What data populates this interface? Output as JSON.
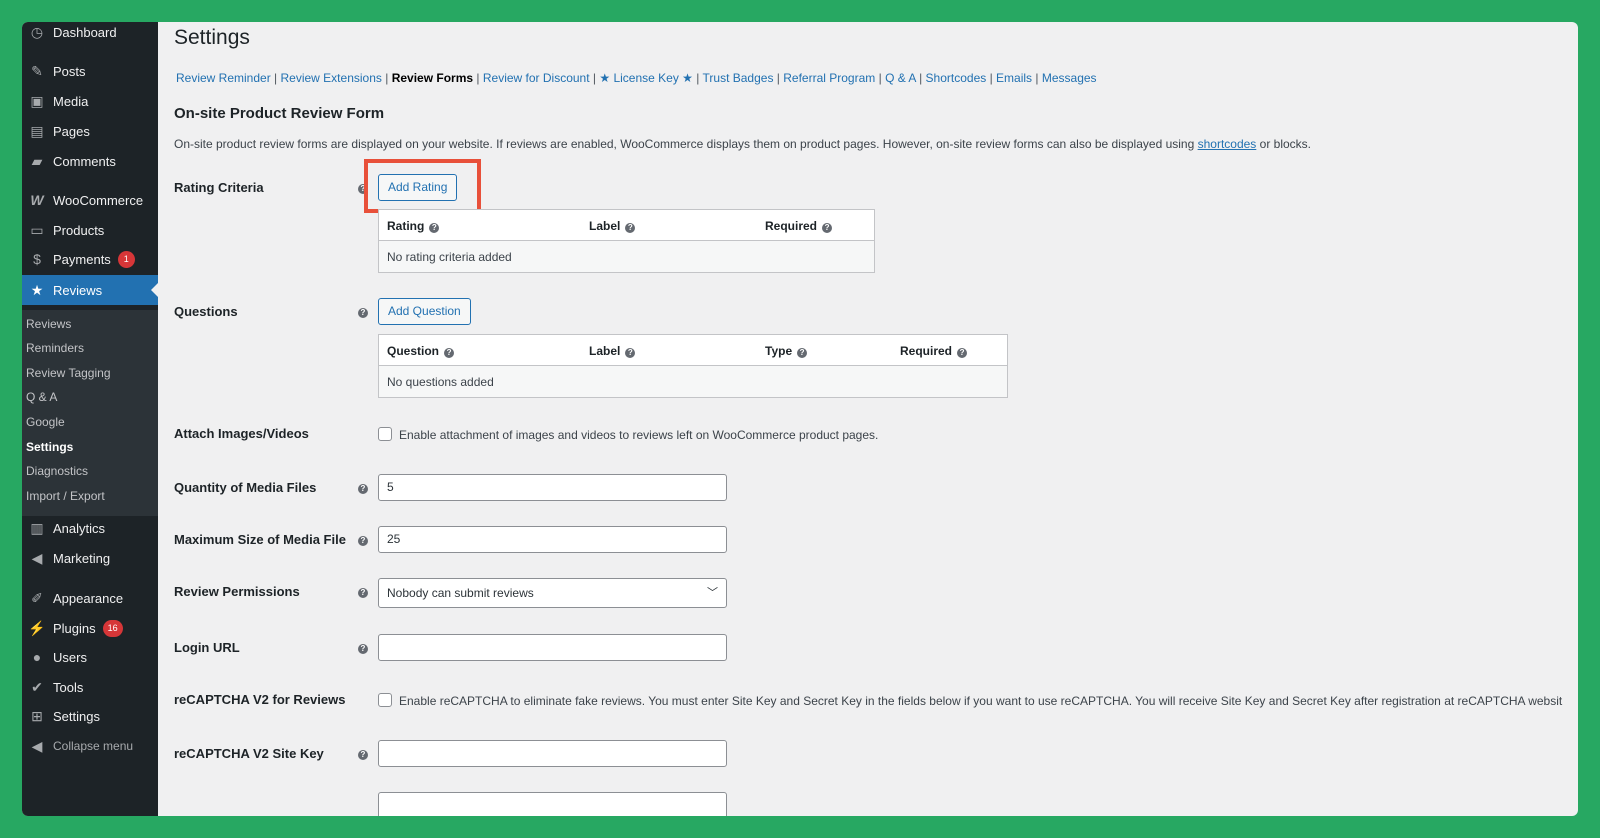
{
  "sidebar": {
    "dashboard": "Dashboard",
    "posts": "Posts",
    "media": "Media",
    "pages": "Pages",
    "comments": "Comments",
    "woocommerce": "WooCommerce",
    "products": "Products",
    "payments": "Payments",
    "payments_badge": "1",
    "reviews": "Reviews",
    "submenu": {
      "reviews": "Reviews",
      "reminders": "Reminders",
      "review_tagging": "Review Tagging",
      "qa": "Q & A",
      "google": "Google",
      "settings": "Settings",
      "diagnostics": "Diagnostics",
      "import_export": "Import / Export"
    },
    "analytics": "Analytics",
    "marketing": "Marketing",
    "appearance": "Appearance",
    "plugins": "Plugins",
    "plugins_badge": "16",
    "users": "Users",
    "tools": "Tools",
    "settings": "Settings",
    "collapse": "Collapse menu"
  },
  "page": {
    "title": "Settings",
    "tabs": [
      "Review Reminder",
      "Review Extensions",
      "Review Forms",
      "Review for Discount",
      "★ License Key ★",
      "Trust Badges",
      "Referral Program",
      "Q & A",
      "Shortcodes",
      "Emails",
      "Messages"
    ],
    "section_title": "On-site Product Review Form",
    "desc_before": "On-site product review forms are displayed on your website. If reviews are enabled, WooCommerce displays them on product pages. However, on-site review forms can also be displayed using ",
    "desc_link": "shortcodes",
    "desc_after": " or blocks."
  },
  "form": {
    "rating_criteria": {
      "label": "Rating Criteria",
      "button": "Add Rating",
      "columns": [
        "Rating",
        "Label",
        "Required"
      ],
      "empty": "No rating criteria added"
    },
    "questions": {
      "label": "Questions",
      "button": "Add Question",
      "columns": [
        "Question",
        "Label",
        "Type",
        "Required"
      ],
      "empty": "No questions added"
    },
    "attach": {
      "label": "Attach Images/Videos",
      "checkbox_text": "Enable attachment of images and videos to reviews left on WooCommerce product pages."
    },
    "quantity": {
      "label": "Quantity of Media Files",
      "value": "5"
    },
    "max_size": {
      "label": "Maximum Size of Media File",
      "value": "25"
    },
    "permissions": {
      "label": "Review Permissions",
      "value": "Nobody can submit reviews"
    },
    "login_url": {
      "label": "Login URL",
      "value": ""
    },
    "recaptcha": {
      "label": "reCAPTCHA V2 for Reviews",
      "checkbox_text": "Enable reCAPTCHA to eliminate fake reviews. You must enter Site Key and Secret Key in the fields below if you want to use reCAPTCHA. You will receive Site Key and Secret Key after registration at reCAPTCHA websit"
    },
    "site_key": {
      "label": "reCAPTCHA V2 Site Key",
      "value": ""
    }
  },
  "colors": {
    "frame_bg": "#27a862",
    "accent": "#2271b1",
    "highlight": "#e8503a",
    "sidebar": "#1d2327"
  }
}
